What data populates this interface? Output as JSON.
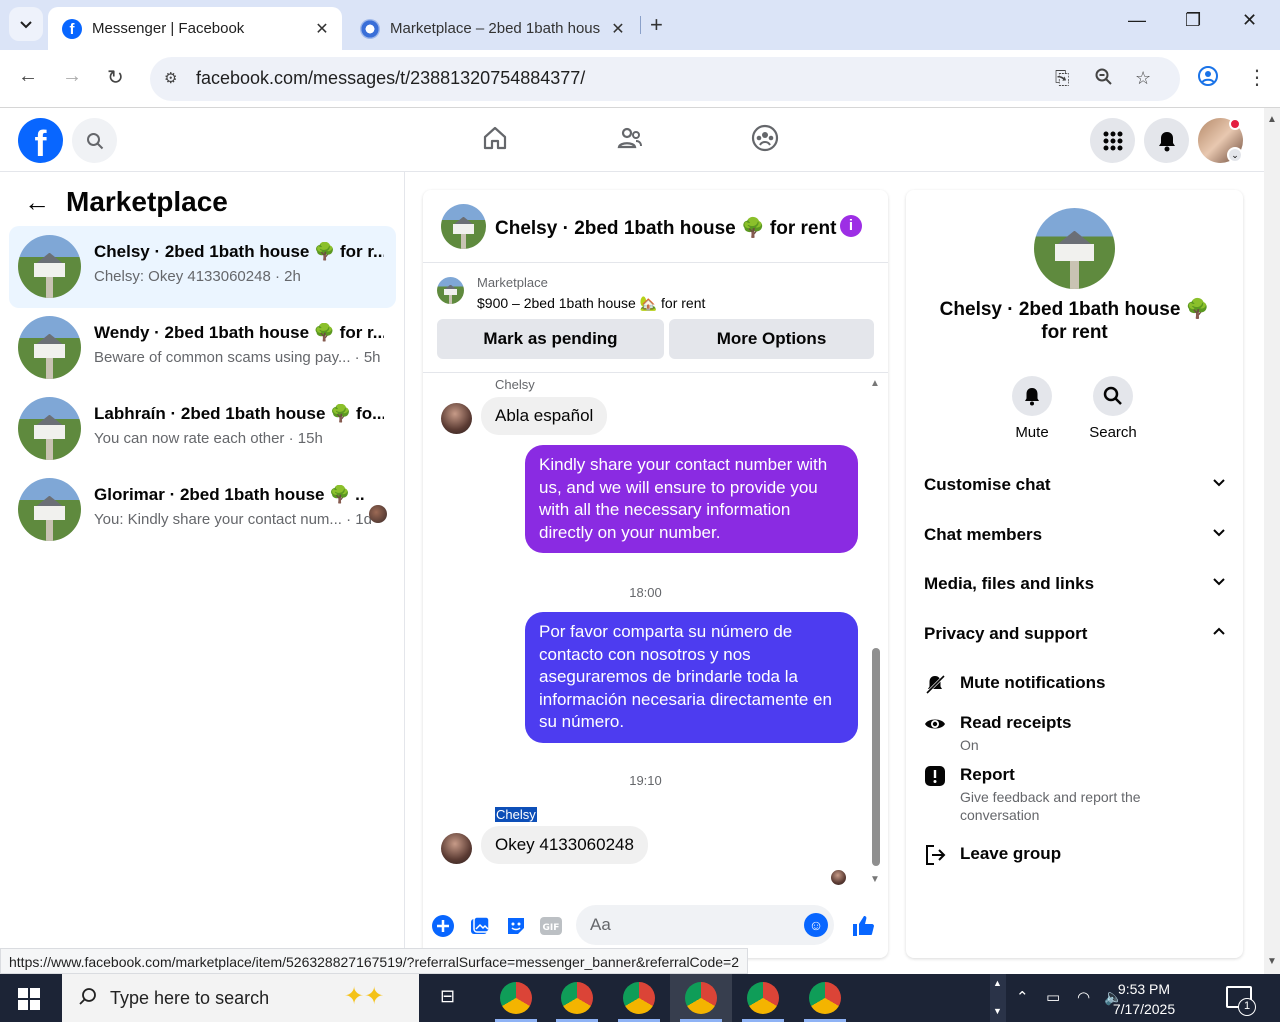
{
  "browser": {
    "tabs": [
      {
        "title": "Messenger | Facebook",
        "active": true
      },
      {
        "title": "Marketplace – 2bed 1bath hous",
        "active": false
      }
    ],
    "url": "facebook.com/messages/t/23881320754884377/",
    "status_url": "https://www.facebook.com/marketplace/item/526328827167519/?referralSurface=messenger_banner&referralCode=2"
  },
  "left": {
    "title": "Marketplace",
    "conversations": [
      {
        "name": "Chelsy · 2bed 1bath house 🌳 for r...",
        "snippet": "Chelsy: Okey 4133060248",
        "time": "· 2h",
        "active": true
      },
      {
        "name": "Wendy · 2bed 1bath house 🌳 for r...",
        "snippet": "Beware of common scams using pay...",
        "time": "· 5h",
        "active": false
      },
      {
        "name": "Labhraín · 2bed 1bath house 🌳 fo...",
        "snippet": "You can now rate each other",
        "time": "· 15h",
        "active": false
      },
      {
        "name": "Glorimar · 2bed 1bath house 🌳 ...",
        "snippet": "You: Kindly share your contact num...",
        "time": "· 1d",
        "active": false
      }
    ]
  },
  "chat": {
    "title": "Chelsy · 2bed 1bath house 🌳 for rent",
    "listing_source": "Marketplace",
    "listing_price": "$900 – 2bed 1bath house 🏡 for rent",
    "buttons": {
      "pending": "Mark as pending",
      "more": "More Options"
    },
    "sender_name": "Chelsy",
    "messages": {
      "in1": "Abla español",
      "out1": "Kindly share your contact number with us, and we will ensure to provide you with all the necessary information directly on your number.",
      "time1": "18:00",
      "out2": "Por favor comparta su número de contacto con nosotros y nos aseguraremos de brindarle toda la información necesaria directamente en su número.",
      "time2": "19:10",
      "in2": "Okey 4133060248"
    },
    "composer_placeholder": "Aa",
    "colors": {
      "out1": "#8a2be2",
      "out2": "#4d3cf0",
      "accent": "#0866ff"
    }
  },
  "info": {
    "title": "Chelsy · 2bed 1bath house 🌳 for rent",
    "actions": {
      "mute": "Mute",
      "search": "Search"
    },
    "sections": {
      "customise": "Customise chat",
      "members": "Chat members",
      "media": "Media, files and links",
      "privacy": "Privacy and support"
    },
    "options": {
      "mute_notifications": "Mute notifications",
      "read_receipts": "Read receipts",
      "read_receipts_sub": "On",
      "report": "Report",
      "report_sub": "Give feedback and report the conversation",
      "leave": "Leave group"
    }
  },
  "taskbar": {
    "search_placeholder": "Type here to search",
    "time": "9:53 PM",
    "date": "7/17/2025",
    "notification_count": "1"
  }
}
